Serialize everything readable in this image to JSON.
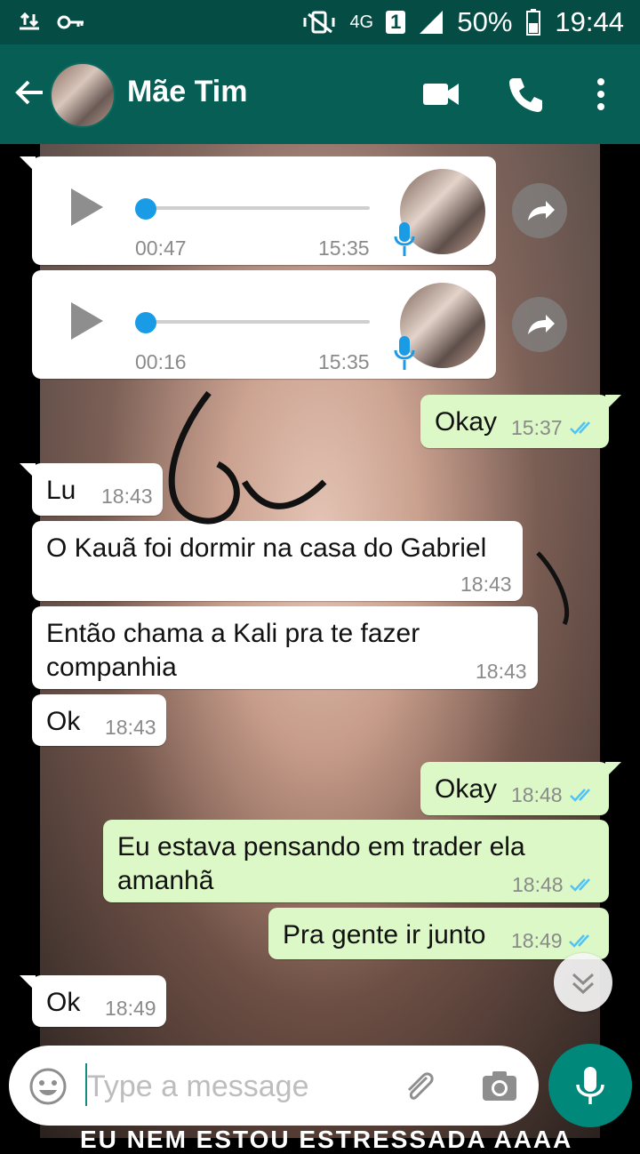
{
  "status_bar": {
    "network": "4G",
    "sim": "1",
    "battery": "50%",
    "time": "19:44"
  },
  "header": {
    "title": "Mãe Tim"
  },
  "messages": [
    {
      "kind": "voice",
      "dir": "in",
      "duration": "00:47",
      "time": "15:35"
    },
    {
      "kind": "voice",
      "dir": "in",
      "duration": "00:16",
      "time": "15:35"
    },
    {
      "kind": "text",
      "dir": "out",
      "text": "Okay",
      "time": "15:37"
    },
    {
      "kind": "text",
      "dir": "in",
      "text": "Lu",
      "time": "18:43"
    },
    {
      "kind": "text",
      "dir": "in",
      "text": "O Kauã foi dormir na casa do Gabriel",
      "time": "18:43"
    },
    {
      "kind": "text",
      "dir": "in",
      "text": "Então chama a Kali pra te fazer\ncompanhia",
      "time": "18:43"
    },
    {
      "kind": "text",
      "dir": "in",
      "text": "Ok",
      "time": "18:43"
    },
    {
      "kind": "text",
      "dir": "out",
      "text": "Okay",
      "time": "18:48"
    },
    {
      "kind": "text",
      "dir": "out",
      "text": "Eu estava pensando em trader ela\namanhã",
      "time": "18:48"
    },
    {
      "kind": "text",
      "dir": "out",
      "text": "Pra gente ir junto",
      "time": "18:49"
    },
    {
      "kind": "text",
      "dir": "in",
      "text": "Ok",
      "time": "18:49"
    }
  ],
  "composer": {
    "placeholder": "Type a message"
  },
  "background_text": "EU NEM ESTOU ESTRESSADA AAAA",
  "colors": {
    "header": "#075e54",
    "status": "#054d44",
    "outgoing_bubble": "#dcf8c6",
    "incoming_bubble": "#ffffff",
    "read_tick": "#4fc3f7",
    "mic_button": "#00897b"
  },
  "icons": [
    "back-arrow-icon",
    "video-call-icon",
    "phone-icon",
    "more-vert-icon",
    "play-icon",
    "mic-icon",
    "forward-icon",
    "double-check-icon",
    "chevron-down-icon",
    "emoji-icon",
    "attach-icon",
    "camera-icon"
  ]
}
